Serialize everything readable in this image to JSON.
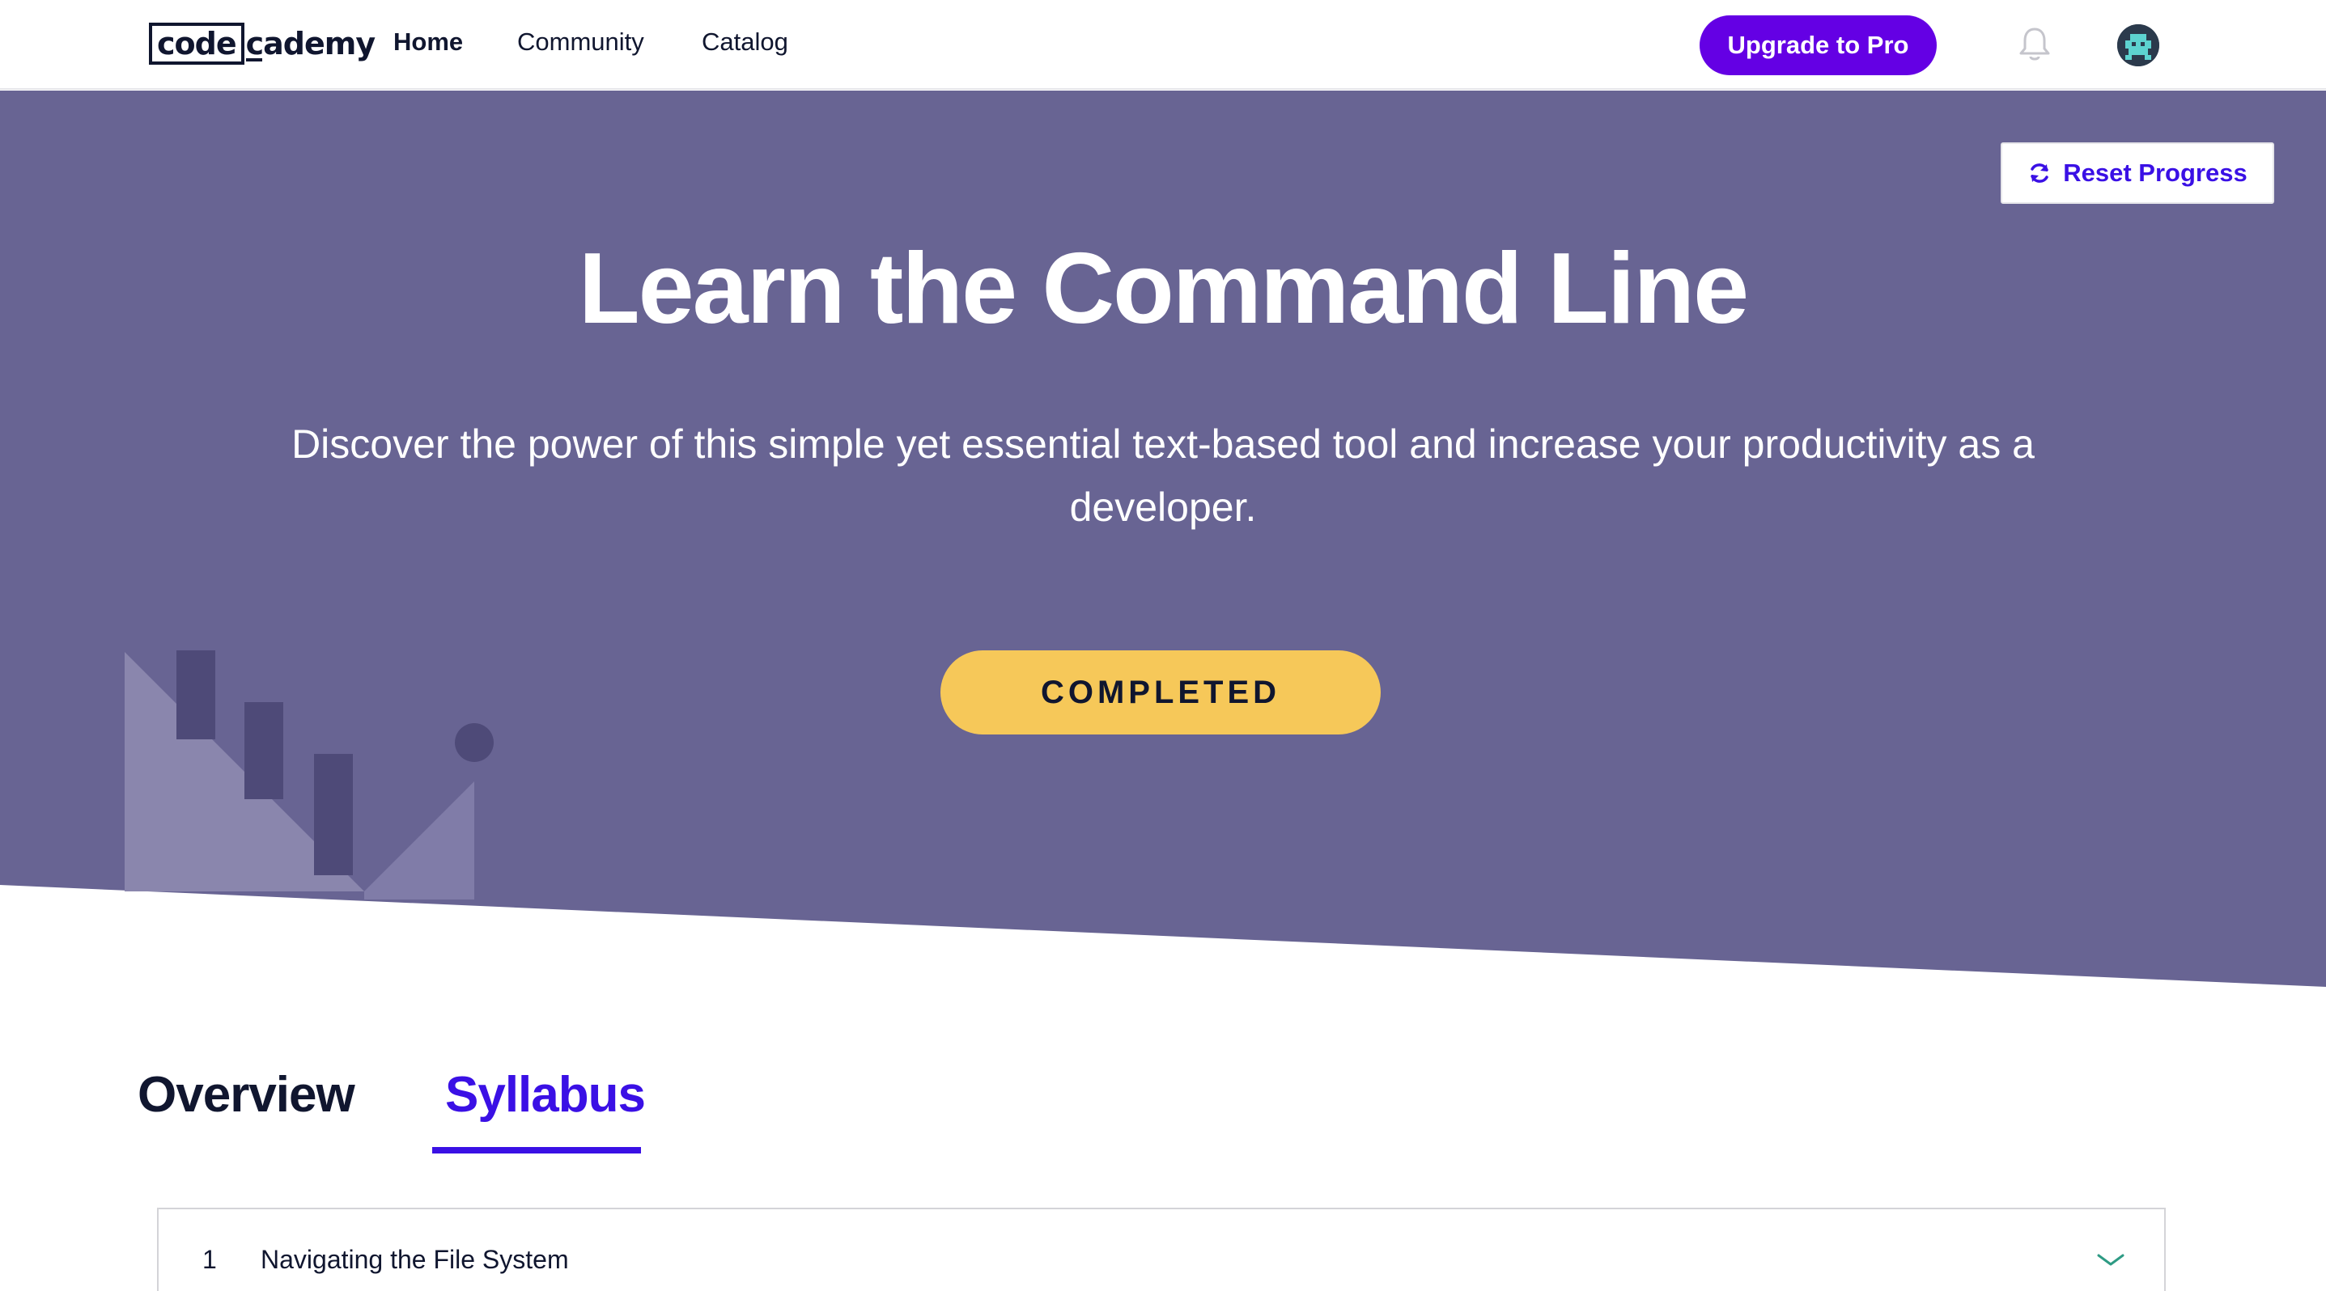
{
  "nav": {
    "logo_box": "code",
    "logo_rest": "cademy",
    "links": [
      "Home",
      "Community",
      "Catalog"
    ],
    "upgrade_label": "Upgrade to Pro",
    "bell_icon": "bell-icon",
    "avatar_icon": "avatar"
  },
  "hero": {
    "reset_label": "Reset Progress",
    "reset_icon": "refresh-icon",
    "title": "Learn the Command Line",
    "subtitle": "Discover the power of this simple yet essential text-based tool and increase your productivity as a developer.",
    "status_label": "COMPLETED"
  },
  "tabs": {
    "overview": "Overview",
    "syllabus": "Syllabus",
    "active": "Syllabus"
  },
  "syllabus": {
    "modules": [
      {
        "number": "1",
        "title": "Navigating the File System"
      }
    ],
    "expand_icon": "chevron-down-icon"
  },
  "colors": {
    "hero_bg": "#686493",
    "brand_purple": "#6400e4",
    "accent_blue": "#3a10e5",
    "completed_yellow": "#f6c859",
    "text_dark": "#10162f",
    "chevron_green": "#2e9b84"
  }
}
